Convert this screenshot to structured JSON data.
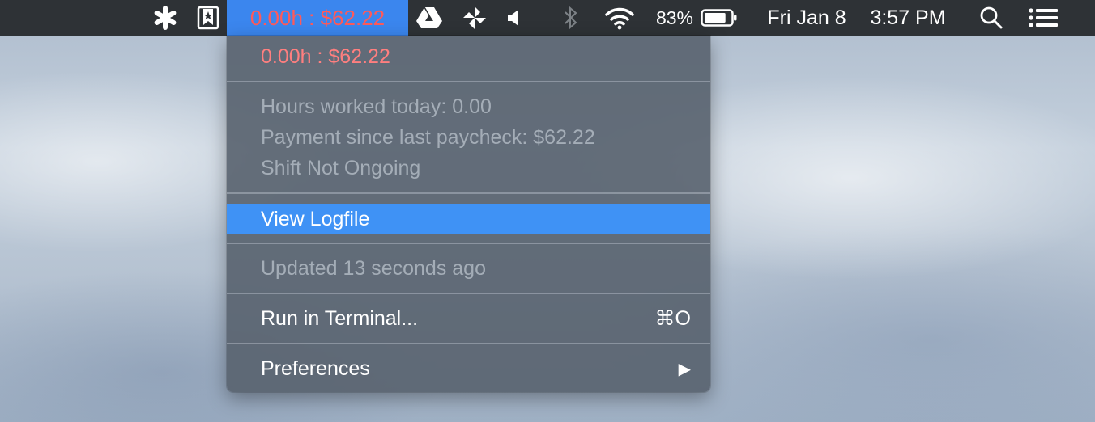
{
  "menubar": {
    "items": [
      {
        "name": "asterisk-icon"
      },
      {
        "name": "bookmark-star-icon"
      },
      {
        "name": "timesheet-status",
        "text": "0.00h : $62.22"
      },
      {
        "name": "google-drive-icon"
      },
      {
        "name": "pinwheel-icon"
      },
      {
        "name": "volume-icon"
      },
      {
        "name": "bluetooth-icon"
      },
      {
        "name": "wifi-icon"
      }
    ],
    "battery_percent": "83%",
    "battery_level": 0.83,
    "date": "Fri Jan 8",
    "time": "3:57 PM"
  },
  "menu": {
    "header": "0.00h : $62.22",
    "info": {
      "hours_today": "Hours worked today: 0.00",
      "payment": "Payment since last paycheck: $62.22",
      "shift": "Shift Not Ongoing"
    },
    "view_logfile": "View Logfile",
    "updated": "Updated 13 seconds ago",
    "run_terminal": "Run in Terminal...",
    "run_terminal_shortcut": "⌘O",
    "preferences": "Preferences",
    "preferences_arrow": "▶"
  },
  "colors": {
    "menubar_bg": "#2e3236",
    "active_item_bg": "#3b86ee",
    "money_text": "#ff5a5a",
    "highlight": "#3f92f5"
  }
}
